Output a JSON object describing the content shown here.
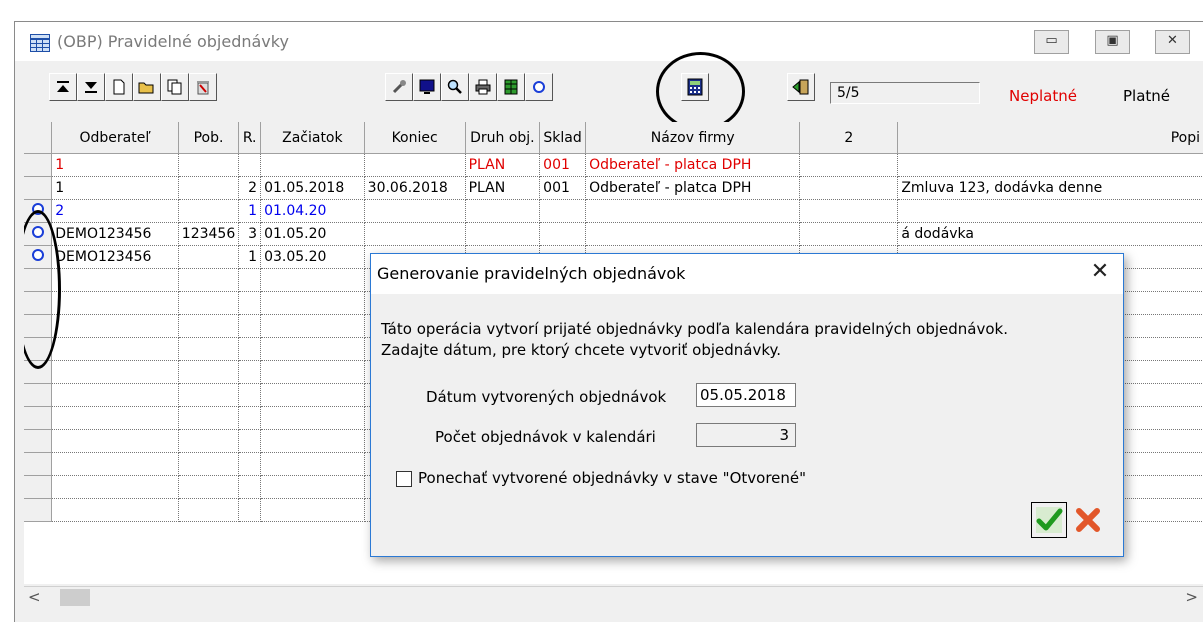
{
  "window": {
    "title": "(OBP) Pravidelné objednávky",
    "counter": "5/5",
    "filter_invalid": "Neplatné",
    "filter_valid": "Platné",
    "controls": {
      "minimize": "▭",
      "maximize": "▣",
      "close": "✕"
    }
  },
  "toolbar": {
    "icons": [
      "move-first-icon",
      "move-last-icon",
      "new-document-icon",
      "open-folder-icon",
      "copy-icon",
      "delete-icon",
      "tools-icon",
      "monitor-icon",
      "search-icon",
      "print-icon",
      "export-icon",
      "marker-icon",
      "calculator-icon",
      "exit-icon"
    ]
  },
  "grid": {
    "columns": [
      "Odberateľ",
      "Pob.",
      "R.",
      "Začiatok",
      "Koniec",
      "Druh obj.",
      "Sklad",
      "Názov firmy",
      "2",
      "Popi"
    ],
    "rows": [
      {
        "marker": false,
        "style": "red",
        "cells": [
          "1",
          "",
          "",
          "",
          "",
          "PLAN",
          "001",
          "Odberateľ - platca DPH",
          "",
          ""
        ]
      },
      {
        "marker": false,
        "style": "",
        "cells": [
          "1",
          "",
          "2",
          "01.05.2018",
          "30.06.2018",
          "PLAN",
          "001",
          "Odberateľ - platca DPH",
          "",
          "Zmluva 123, dodávka denne"
        ]
      },
      {
        "marker": true,
        "style": "blue",
        "cells": [
          "2",
          "",
          "1",
          "01.04.20",
          "",
          "",
          "",
          "",
          "",
          ""
        ]
      },
      {
        "marker": true,
        "style": "",
        "cells": [
          "DEMO123456",
          "123456",
          "3",
          "01.05.20",
          "",
          "",
          "",
          "",
          "",
          "á dodávka"
        ]
      },
      {
        "marker": true,
        "style": "",
        "cells": [
          "DEMO123456",
          "",
          "1",
          "03.05.20",
          "",
          "",
          "",
          "",
          "",
          ""
        ]
      }
    ],
    "empty_rows": 11
  },
  "dialog": {
    "title": "Generovanie pravidelných objednávok",
    "description_line1": "Táto operácia vytvorí prijaté objednávky podľa kalendára pravidelných objednávok.",
    "description_line2": "Zadajte dátum, pre ktorý chcete vytvoriť objednávky.",
    "date_label": "Dátum vytvorených objednávok",
    "date_value": "05.05.2018",
    "count_label": "Počet objednávok v kalendári",
    "count_value": "3",
    "checkbox_label": "Ponechať vytvorené objednávky v stave \"Otvorené\"",
    "checkbox_checked": false
  },
  "colors": {
    "invalid": "#e00000",
    "link_blue": "#0000ee",
    "dialog_border": "#2b79d4"
  }
}
